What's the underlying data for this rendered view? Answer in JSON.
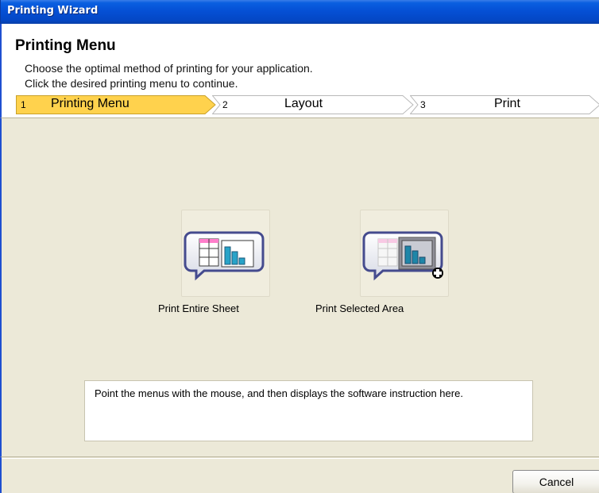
{
  "window": {
    "title": "Printing Wizard"
  },
  "header": {
    "title": "Printing Menu",
    "subtitle_line1": "Choose the optimal method of printing for your application.",
    "subtitle_line2": "Click the desired printing menu to continue."
  },
  "steps": [
    {
      "number": "1",
      "label": "Printing Menu",
      "active": true
    },
    {
      "number": "2",
      "label": "Layout",
      "active": false
    },
    {
      "number": "3",
      "label": "Print",
      "active": false
    }
  ],
  "menu": [
    {
      "label": "Print Entire Sheet",
      "icon": "sheet-chart-icon"
    },
    {
      "label": "Print Selected Area",
      "icon": "selected-area-chart-icon"
    }
  ],
  "info": {
    "text": "Point the menus with the mouse, and then displays the software instruction here."
  },
  "footer": {
    "cancel_label": "Cancel"
  },
  "colors": {
    "titlebar": "#0550d5",
    "active_step": "#ffd24d",
    "inactive_step": "#ffffff",
    "panel": "#ece9d8"
  }
}
